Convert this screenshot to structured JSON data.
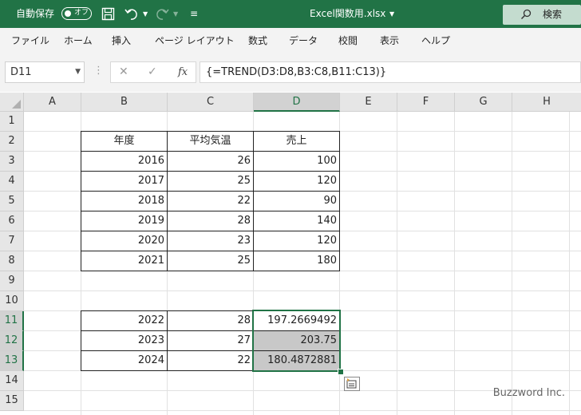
{
  "titlebar": {
    "autosave_label": "自動保存",
    "autosave_state": "オフ",
    "filename": "Excel関数用.xlsx",
    "search_label": "検索"
  },
  "ribbon": {
    "tabs": [
      "ファイル",
      "ホーム",
      "挿入",
      "ページ レイアウト",
      "数式",
      "データ",
      "校閲",
      "表示",
      "ヘルプ"
    ]
  },
  "formula_bar": {
    "name_box": "D11",
    "formula": "{=TREND(D3:D8,B3:C8,B11:C13)}",
    "fx_label": "fx"
  },
  "columns": [
    "A",
    "B",
    "C",
    "D",
    "E",
    "F",
    "G",
    "H"
  ],
  "rows": [
    "1",
    "2",
    "3",
    "4",
    "5",
    "6",
    "7",
    "8",
    "9",
    "10",
    "11",
    "12",
    "13",
    "14",
    "15"
  ],
  "table": {
    "headers": [
      "年度",
      "平均気温",
      "売上"
    ],
    "rows": [
      [
        "2016",
        "26",
        "100"
      ],
      [
        "2017",
        "25",
        "120"
      ],
      [
        "2018",
        "22",
        "90"
      ],
      [
        "2019",
        "28",
        "140"
      ],
      [
        "2020",
        "23",
        "120"
      ],
      [
        "2021",
        "25",
        "180"
      ]
    ]
  },
  "forecast": {
    "rows": [
      [
        "2022",
        "28",
        "197.2669492"
      ],
      [
        "2023",
        "27",
        "203.75"
      ],
      [
        "2024",
        "22",
        "180.4872881"
      ]
    ]
  },
  "selected_cell": "D11",
  "watermark": "Buzzword Inc.",
  "colors": {
    "excel_green": "#217346",
    "selection_gray": "#c8c8c8"
  }
}
